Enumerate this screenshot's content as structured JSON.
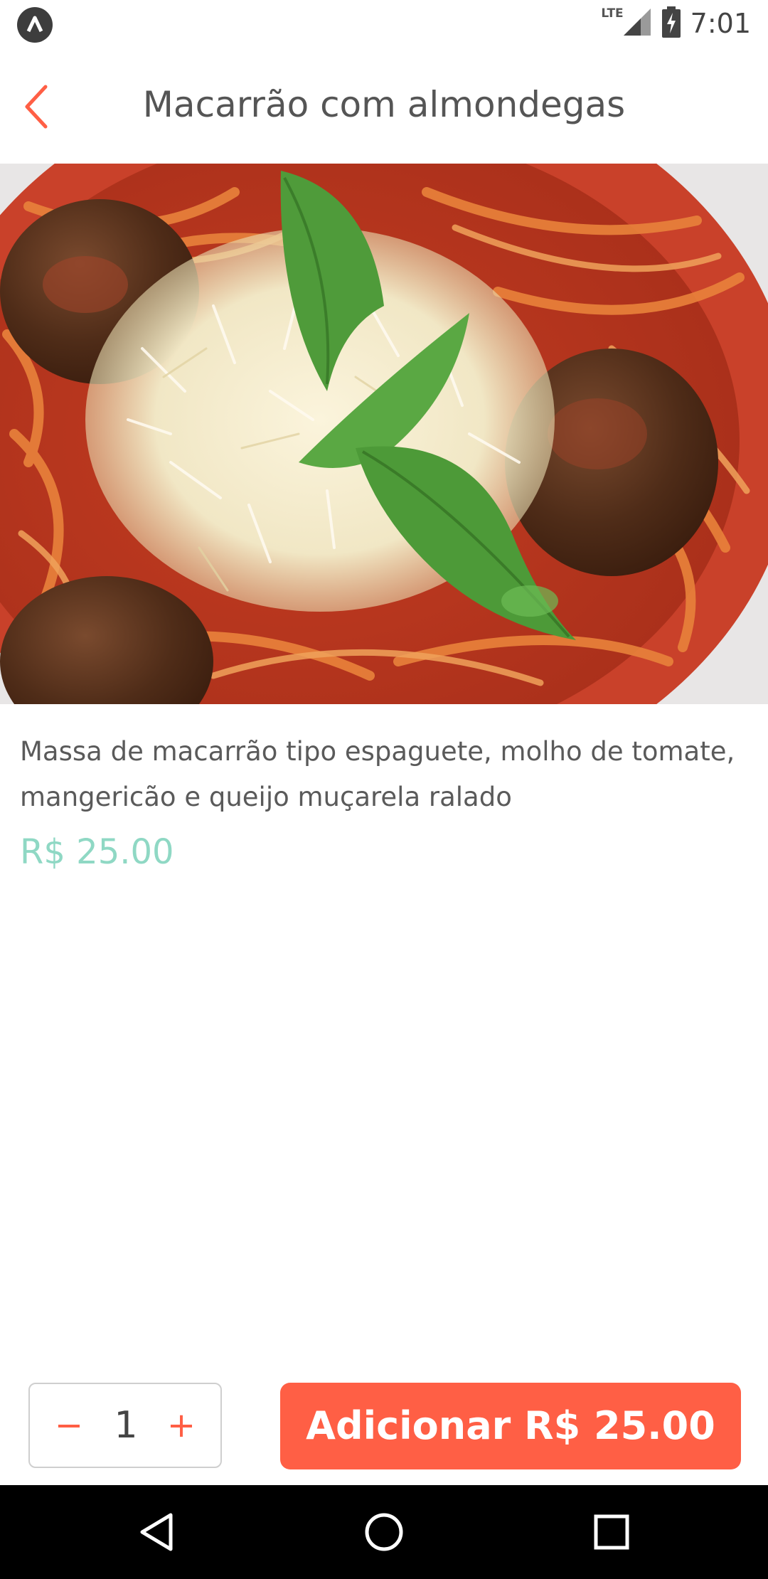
{
  "status_bar": {
    "network": "LTE",
    "time": "7:01",
    "icons": [
      "app-notification-icon",
      "signal-icon",
      "battery-charging-icon"
    ]
  },
  "header": {
    "title": "Macarrão com almondegas",
    "back_icon": "chevron-left-icon"
  },
  "product": {
    "image": "spaghetti-with-meatballs-photo",
    "description": "Massa de macarrão tipo espaguete, molho de tomate, mangericão e queijo muçarela ralado",
    "price": "R$ 25.00"
  },
  "cart": {
    "minus_label": "−",
    "quantity": "1",
    "plus_label": "+",
    "add_button_label": "Adicionar R$ 25.00"
  },
  "nav_bar": {
    "buttons": [
      "back-triangle-icon",
      "home-circle-icon",
      "recents-square-icon"
    ]
  },
  "colors": {
    "accent": "#FF5F45",
    "price": "#8FD8C4",
    "title_text": "#555555",
    "nav_background": "#000000"
  }
}
